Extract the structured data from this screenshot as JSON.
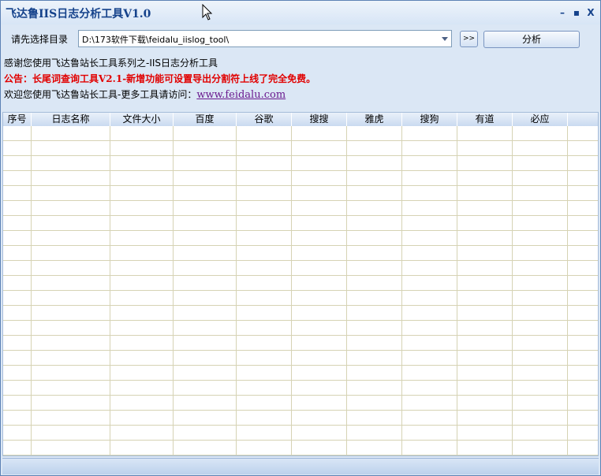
{
  "window": {
    "title": "飞达鲁IIS日志分析工具V1.0",
    "buttons": [
      "–",
      "▪",
      "X"
    ]
  },
  "toolbar": {
    "dir_label": "请先选择目录",
    "path_value": "D:\\173软件下载\\feidalu_iislog_tool\\",
    "browse_label": ">>",
    "analyze_label": "分析"
  },
  "info": {
    "thanks": "感谢您使用飞达鲁站长工具系列之-IIS日志分析工具",
    "notice": "公告：长尾词查询工具V2.1-新增功能可设置导出分割符上线了完全免费。",
    "welcome_prefix": "欢迎您使用飞达鲁站长工具-更多工具请访问：",
    "link": "www.feidalu.com"
  },
  "grid": {
    "columns": [
      "序号",
      "日志名称",
      "文件大小",
      "百度",
      "谷歌",
      "搜搜",
      "雅虎",
      "搜狗",
      "有道",
      "必应"
    ],
    "rows": []
  },
  "colors": {
    "title": "#15428b",
    "notice": "#e10000",
    "link": "#6a1a8f",
    "gridline": "#d6d3b4"
  }
}
